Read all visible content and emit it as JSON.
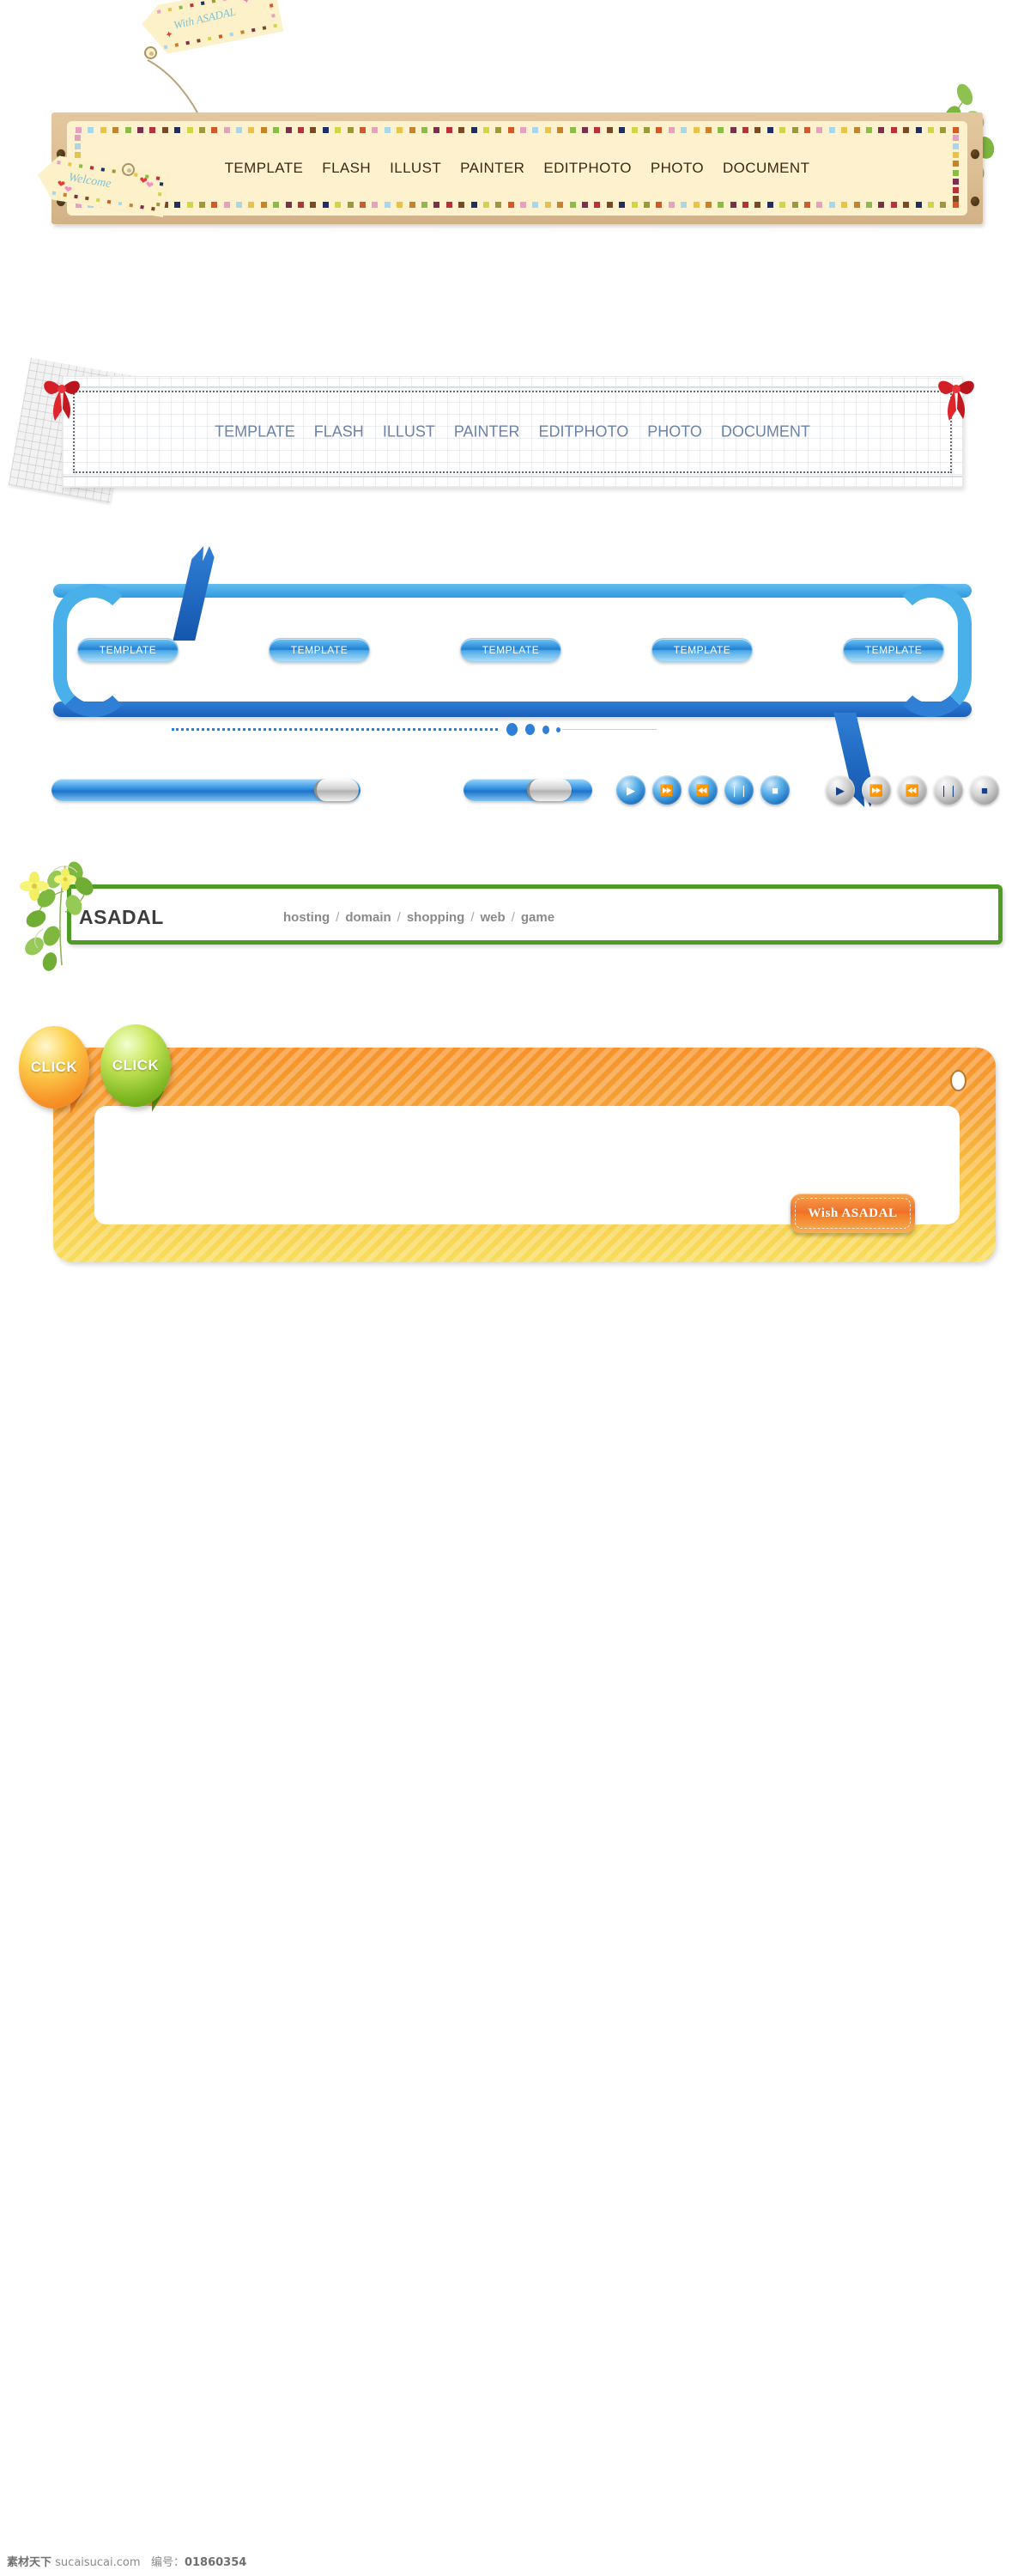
{
  "banner_beige": {
    "name": "vintage-tag-navigation-banner",
    "menu": [
      "TEMPLATE",
      "FLASH",
      "ILLUST",
      "PAINTER",
      "EDITPHOTO",
      "PHOTO",
      "DOCUMENT"
    ],
    "tags": [
      {
        "id": "with-asadal",
        "text": "With ASADAL"
      },
      {
        "id": "welcome",
        "text": "Welcome"
      }
    ],
    "colors": {
      "frame": "#dcbf94",
      "paper": "#fdf2cd",
      "text": "#3b2a14",
      "tag_text": "#7fc3d8"
    }
  },
  "banner_paper": {
    "name": "grid-paper-navigation-banner",
    "menu": [
      "TEMPLATE",
      "FLASH",
      "ILLUST",
      "PAINTER",
      "EDITPHOTO",
      "PHOTO",
      "DOCUMENT"
    ],
    "colors": {
      "text": "#6b83a8",
      "ribbon": "#cf1f24",
      "grid": "#a5afbe"
    }
  },
  "banner_blue": {
    "name": "blue-ribbon-frame",
    "buttons": [
      "TEMPLATE",
      "TEMPLATE",
      "TEMPLATE",
      "TEMPLATE",
      "TEMPLATE"
    ],
    "colors": {
      "light": "#4ab0ea",
      "dark": "#1f72c8",
      "button_text": "#ffffff"
    }
  },
  "controls": {
    "name": "progress-and-media-controls",
    "progress_bars": [
      {
        "id": "long",
        "label": ""
      },
      {
        "id": "short",
        "label": ""
      }
    ],
    "media_blue": [
      {
        "icon": "play-icon",
        "glyph": "▶"
      },
      {
        "icon": "fast-forward-icon",
        "glyph": "⏩"
      },
      {
        "icon": "rewind-icon",
        "glyph": "⏪"
      },
      {
        "icon": "pause-icon",
        "glyph": "❘❘"
      },
      {
        "icon": "stop-icon",
        "glyph": "■"
      }
    ],
    "media_grey": [
      {
        "icon": "play-icon",
        "glyph": "▶"
      },
      {
        "icon": "fast-forward-icon",
        "glyph": "⏩"
      },
      {
        "icon": "rewind-icon",
        "glyph": "⏪"
      },
      {
        "icon": "pause-icon",
        "glyph": "❘❘"
      },
      {
        "icon": "stop-icon",
        "glyph": "■"
      }
    ]
  },
  "banner_green": {
    "name": "green-asadal-bar",
    "brand": "ASADAL",
    "links": [
      "hosting",
      "domain",
      "shopping",
      "web",
      "game"
    ],
    "separator": "/",
    "colors": {
      "border": "#4f9c24",
      "brand_text": "#3d3d3d",
      "link_text": "#8a8a8a"
    }
  },
  "banner_orange": {
    "name": "orange-striped-frame",
    "bubbles": [
      {
        "id": "orange-bubble",
        "label": "CLICK"
      },
      {
        "id": "green-bubble",
        "label": "CLICK"
      }
    ],
    "action_button": "Wish  ASADAL",
    "colors": {
      "top": "#f79229",
      "bottom": "#f9dd5c",
      "button": "#ef6f2a"
    }
  },
  "footer": {
    "site_cn": "素材天下",
    "site_url": "sucaisucai.com",
    "id_label": "编号：",
    "id_value": "01860354"
  }
}
